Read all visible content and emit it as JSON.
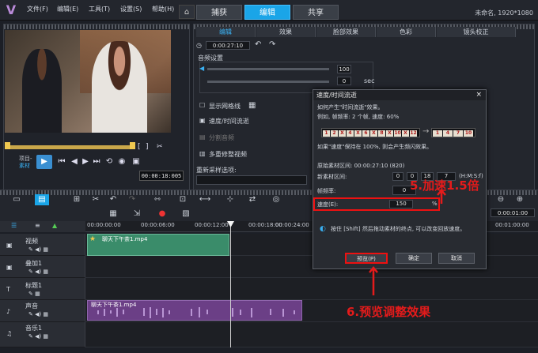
{
  "menubar": {
    "items": [
      "文件(F)",
      "编辑(E)",
      "工具(T)",
      "设置(S)",
      "帮助(H)"
    ],
    "tabs": [
      "捕获",
      "编辑",
      "共享"
    ],
    "active_tab": "编辑",
    "project": "未命名, 1920*1080"
  },
  "preview": {
    "labels": [
      "项目-",
      "素材"
    ],
    "timecode": "00:00:18:005",
    "mode_buttons": [
      "[",
      "]",
      "✂"
    ]
  },
  "options": {
    "tabs": [
      "编辑",
      "效果",
      "脸部效果",
      "色彩",
      "镜头校正"
    ],
    "active_tab": "编辑",
    "duration": "0:00:27:10",
    "audio_settings": "音频设置",
    "volume": "100",
    "fade": "0",
    "sec": "sec",
    "items": [
      "显示网格线",
      "速度/时间流逝",
      "分割音频",
      "多重修整视频"
    ],
    "resample_label": "重新采样选项:"
  },
  "dialog": {
    "title": "速度/时间流逝",
    "close": "×",
    "desc1": "如何产生\"时间流逝\"效果。",
    "desc2": "例如, 帧频率: 2 个帧, 速度: 60%",
    "keep_frames": [
      "1",
      "2",
      "X",
      "4",
      "X",
      "6",
      "X",
      "8",
      "X",
      "10",
      "X",
      "12"
    ],
    "result_frames": [
      "1",
      "4",
      "7",
      "10"
    ],
    "note": "如果\"速度\"保持在 100%, 则会产生频闪效果。",
    "original_label": "原始素材区间: 00:00:27:10 (820)",
    "new_label": "新素材区间:",
    "new_h": "0",
    "new_m": "0",
    "new_s": "18",
    "new_f": "7",
    "hmsf": "(H:M:S:f)",
    "frame_label": "帧频率:",
    "frame_value": "0",
    "speed_label": "速度(E):",
    "speed_value": "150",
    "percent": "%",
    "hint": "按住 [Shift] 然后拖动素材的终点, 可以改变回放速度。",
    "buttons": {
      "preview": "预览(P)",
      "ok": "确定",
      "cancel": "取消"
    }
  },
  "annotations": {
    "step5": "5.加速1.5倍",
    "step6": "6.预览调整效果"
  },
  "timeline": {
    "ruler": [
      "00:00:00:00",
      "00:00:06:00",
      "00:00:12:00",
      "00:00:18:00",
      "00:00:24:00"
    ],
    "ruler_right": "00:01:00:00",
    "tracks": [
      "视频",
      "叠加1",
      "标题1",
      "声音",
      "音乐1"
    ],
    "video_clip": "聊天下午茶1.mp4",
    "audio_clip": "聊天下午茶1.mp4",
    "zoom_time": "0:00:01:00"
  },
  "colors": {
    "accent": "#1aa5e8",
    "video_clip": "#3a8c6a",
    "audio_clip": "#6b3f86",
    "highlight": "#e11"
  }
}
